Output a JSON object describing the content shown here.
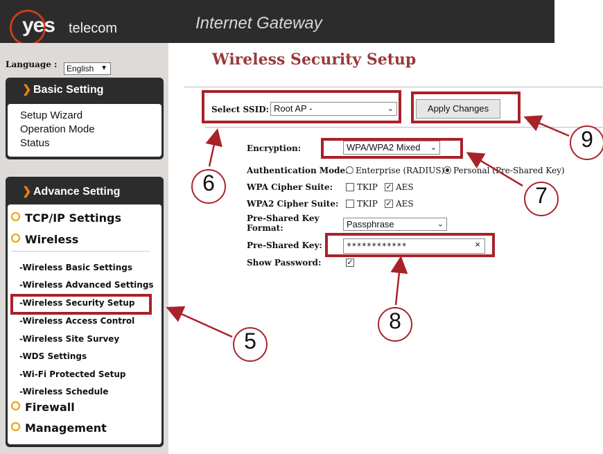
{
  "header": {
    "logo_yes": "yes",
    "logo_telecom": "telecom",
    "title": "Internet Gateway"
  },
  "sidebar": {
    "language_label": "Language :",
    "language_value": "English",
    "basic": {
      "title": "Basic Setting",
      "items": [
        "Setup Wizard",
        "Operation Mode",
        "Status"
      ]
    },
    "advance": {
      "title": "Advance Setting",
      "groups": [
        "TCP/IP Settings",
        "Wireless",
        "Firewall",
        "Management"
      ],
      "wireless_items": [
        "-Wireless Basic Settings",
        "-Wireless Advanced Settings",
        "-Wireless Security Setup",
        "-Wireless Access Control",
        "-Wireless Site Survey",
        "-WDS Settings",
        "-Wi-Fi Protected Setup",
        "-Wireless Schedule"
      ]
    }
  },
  "main": {
    "title": "Wireless Security Setup",
    "select_ssid_label": "Select SSID:",
    "ssid_value": "Root AP -",
    "apply_label": "Apply Changes",
    "encryption_label": "Encryption:",
    "encryption_value": "WPA/WPA2 Mixed",
    "auth_label": "Authentication Mode:",
    "auth_enterprise": "Enterprise (RADIUS)",
    "auth_personal": "Personal (Pre-Shared Key)",
    "wpa_cipher_label": "WPA Cipher Suite:",
    "wpa2_cipher_label": "WPA2 Cipher Suite:",
    "tkip": "TKIP",
    "aes": "AES",
    "psk_format_label_1": "Pre-Shared Key",
    "psk_format_label_2": "Format:",
    "psk_format_value": "Passphrase",
    "psk_label": "Pre-Shared Key:",
    "psk_value": "************",
    "show_password_label": "Show Password:"
  },
  "annotations": [
    "5",
    "6",
    "7",
    "8",
    "9"
  ],
  "colors": {
    "highlight": "#a8222a",
    "title": "#9a3a3a",
    "accent": "#e8801c"
  }
}
